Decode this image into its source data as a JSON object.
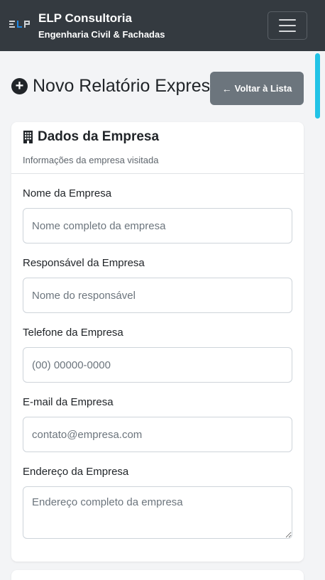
{
  "navbar": {
    "brand_title": "ELP Consultoria",
    "brand_subtitle": "Engenharia Civil & Fachadas",
    "logo_text": "ELP",
    "menu_icon": "hamburger-icon"
  },
  "header": {
    "title": "Novo Relatório Express",
    "title_icon": "plus-circle-icon",
    "back_label": "Voltar à Lista",
    "back_icon": "arrow-left-icon"
  },
  "card": {
    "title": "Dados da Empresa",
    "title_icon": "building-icon",
    "subtitle": "Informações da empresa visitada",
    "fields": [
      {
        "label": "Nome da Empresa",
        "placeholder": "Nome completo da empresa",
        "value": ""
      },
      {
        "label": "Responsável da Empresa",
        "placeholder": "Nome do responsável",
        "value": ""
      },
      {
        "label": "Telefone da Empresa",
        "placeholder": "(00) 00000-0000",
        "value": ""
      },
      {
        "label": "E-mail da Empresa",
        "placeholder": "contato@empresa.com",
        "value": ""
      },
      {
        "label": "Endereço da Empresa",
        "placeholder": "Endereço completo da empresa",
        "value": ""
      }
    ]
  },
  "colors": {
    "navbar_bg": "#343a40",
    "page_bg": "#f3f4f6",
    "secondary_button": "#6c757d",
    "scrollbar_accent": "#22c3e6",
    "logo_accent": "#1e88e5"
  }
}
